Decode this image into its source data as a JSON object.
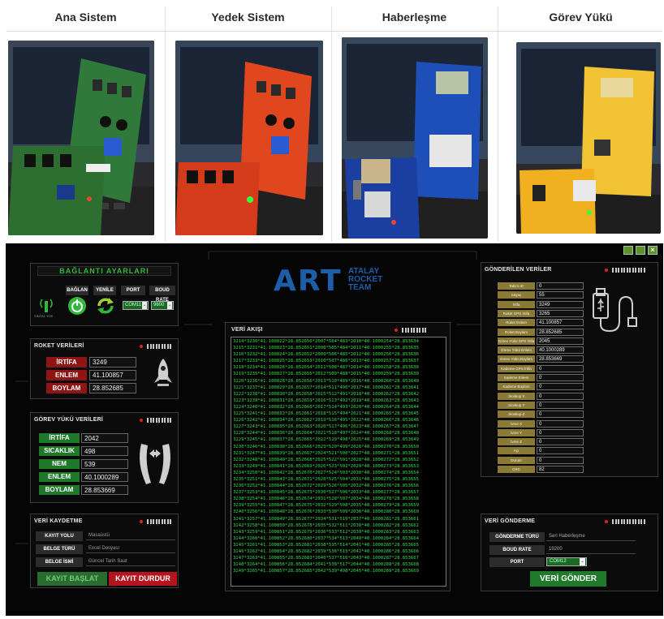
{
  "table": {
    "headers": [
      "Ana Sistem",
      "Yedek Sistem",
      "Haberleşme",
      "Görev Yükü"
    ]
  },
  "window_controls": [
    "minimize-icon",
    "restore-icon",
    "close-icon"
  ],
  "baglanti": {
    "title": "BAĞLANTI AYARLARI",
    "labels": {
      "baglan": "BAĞLAN",
      "yenile": "YENİLE",
      "port": "PORT",
      "boud": "BOUD RATE"
    },
    "signal_text": "SINYAL YOK",
    "port_value": "COM11",
    "boud_value": "9600"
  },
  "roket": {
    "title": "ROKET VERİLERİ",
    "rows": [
      {
        "label": "İRTİFA",
        "value": "3249"
      },
      {
        "label": "ENLEM",
        "value": "41.100857"
      },
      {
        "label": "BOYLAM",
        "value": "28.852685"
      }
    ]
  },
  "gorev": {
    "title": "GÖREV YÜKÜ VERİLERİ",
    "rows": [
      {
        "label": "İRTİFA",
        "value": "2042"
      },
      {
        "label": "SICAKLIK",
        "value": "498"
      },
      {
        "label": "NEM",
        "value": "539"
      },
      {
        "label": "ENLEM",
        "value": "40.1000289"
      },
      {
        "label": "BOYLAM",
        "value": "28.853669"
      }
    ]
  },
  "kaydetme": {
    "title": "VERİ KAYDETME",
    "rows": [
      {
        "label": "KAYIT YOLU",
        "value": "Masaüstü"
      },
      {
        "label": "BELGE TÜRÜ",
        "value": "Excel Dosyası"
      },
      {
        "label": "BELGE İSMİ",
        "value": "Güncel Tarih Saat"
      }
    ],
    "start_label": "KAYIT BAŞLAT",
    "stop_label": "KAYIT DURDUR"
  },
  "logo": {
    "big": "ART",
    "line1": "ATALAY",
    "line2": "ROCKET",
    "line3": "TEAM"
  },
  "akis": {
    "title": "VERİ AKIŞI",
    "lines": [
      "3214*3230*41.100822*28.852650*2007*504*483*2010*40.1000254*28.853634",
      "3215*3231*41.100823*28.852651*2008*505*484*2011*40.1000255*28.853635",
      "3216*3232*41.100824*28.852652*2009*506*485*2012*40.1000256*28.853636",
      "3217*3233*41.100825*28.852653*2010*507*486*2013*40.1000257*28.853637",
      "3218*3234*41.100826*28.852654*2011*508*487*2014*40.1000258*28.853638",
      "3219*3235*41.100827*28.852655*2012*509*488*2015*40.1000259*28.853639",
      "3220*3236*41.100828*28.852656*2013*510*489*2016*40.1000260*28.853640",
      "3221*3237*41.100829*28.852657*2014*511*490*2017*40.1000261*28.853641",
      "3222*3238*41.100830*28.852658*2015*512*491*2018*40.1000262*28.853642",
      "3223*3239*41.100831*28.852659*2016*513*492*2019*40.1000263*28.853643",
      "3224*3240*41.100832*28.852660*2017*514*493*2020*40.1000264*28.853644",
      "3225*3241*41.100833*28.852661*2018*515*494*2021*40.1000265*28.853645",
      "3226*3242*41.100834*28.852662*2019*516*495*2022*40.1000266*28.853646",
      "3227*3243*41.100835*28.852663*2020*517*496*2023*40.1000267*28.853647",
      "3228*3244*41.100836*28.852664*2021*518*497*2024*40.1000268*28.853648",
      "3229*3245*41.100837*28.852665*2022*519*498*2025*40.1000269*28.853649",
      "3230*3246*41.100838*28.852666*2023*520*499*2026*40.1000270*28.853650",
      "3231*3247*41.100839*28.852667*2024*521*500*2027*40.1000271*28.853651",
      "3232*3248*41.100840*28.852668*2025*522*501*2028*40.1000272*28.853652",
      "3233*3249*41.100841*28.852669*2026*523*502*2029*40.1000273*28.853653",
      "3234*3250*41.100842*28.852670*2027*524*503*2030*40.1000274*28.853654",
      "3235*3251*41.100843*28.852671*2028*525*504*2031*40.1000275*28.853655",
      "3236*3252*41.100844*28.852672*2029*526*505*2032*40.1000276*28.853656",
      "3237*3253*41.100845*28.852673*2030*527*506*2033*40.1000277*28.853657",
      "3238*3254*41.100846*28.852674*2031*528*507*2034*40.1000278*28.853658",
      "3239*3255*41.100847*28.852675*2032*529*508*2035*40.1000279*28.853659",
      "3240*3256*41.100848*28.852676*2033*530*509*2036*40.1000280*28.853660",
      "3241*3257*41.100849*28.852677*2034*531*510*2037*40.1000281*28.853661",
      "3242*3258*41.100850*28.852678*2035*532*511*2038*40.1000282*28.853662",
      "3243*3259*41.100851*28.852679*2036*533*512*2039*40.1000283*28.853663",
      "3244*3260*41.100852*28.852680*2037*534*513*2040*40.1000284*28.853664",
      "3245*3261*41.100853*28.852681*2038*535*514*2041*40.1000285*28.853665",
      "3246*3262*41.100854*28.852682*2039*536*515*2042*40.1000286*28.853666",
      "3247*3263*41.100855*28.852683*2040*537*516*2043*40.1000287*28.853667",
      "3248*3264*41.100856*28.852684*2041*538*517*2044*40.1000288*28.853668",
      "3249*3265*41.100857*28.852685*2042*539*498*2045*40.1000289*28.853669"
    ]
  },
  "gonderilen": {
    "title": "GÖNDERİLEN VERİLER",
    "rows": [
      {
        "label": "Takım ID",
        "value": "0"
      },
      {
        "label": "Sayaç",
        "value": "55"
      },
      {
        "label": "İrtifa",
        "value": "3249"
      },
      {
        "label": "Roket GPS İrtifa",
        "value": "3265"
      },
      {
        "label": "Roket Enlem",
        "value": "41.100857"
      },
      {
        "label": "Roket Boylam",
        "value": "28.852685"
      },
      {
        "label": "Görev Yükü GPS İrtifa",
        "value": "2045"
      },
      {
        "label": "Görev Yükü Enlem",
        "value": "40.1000289"
      },
      {
        "label": "Görev Yükü Boylam",
        "value": "28.853669"
      },
      {
        "label": "Kademe GPS İrtifa",
        "value": "0"
      },
      {
        "label": "Kademe Enlem",
        "value": "0"
      },
      {
        "label": "Kademe Boylam",
        "value": "0"
      },
      {
        "label": "Jiroskop X",
        "value": "0"
      },
      {
        "label": "Jiroskop Y",
        "value": "0"
      },
      {
        "label": "Jiroskop Z",
        "value": "0"
      },
      {
        "label": "İvme X",
        "value": "0"
      },
      {
        "label": "İvme Y",
        "value": "0"
      },
      {
        "label": "İvme Z",
        "value": "0"
      },
      {
        "label": "Açı",
        "value": "0"
      },
      {
        "label": "Durum",
        "value": "0"
      },
      {
        "label": "CRC",
        "value": "82"
      }
    ]
  },
  "gonderme": {
    "title": "VERİ GÖNDERME",
    "rows": [
      {
        "label": "GÖNDERME TÜRÜ",
        "value": "Seri Haberleşme"
      },
      {
        "label": "BOUD RATE",
        "value": "19200"
      },
      {
        "label": "PORT",
        "value": "COM12"
      }
    ],
    "send_label": "VERİ GÖNDER"
  },
  "colors": {
    "accent_red": "#8f1414",
    "accent_green": "#1e7a2a",
    "stream_green": "#33e14a",
    "olive": "#8a7a35"
  }
}
